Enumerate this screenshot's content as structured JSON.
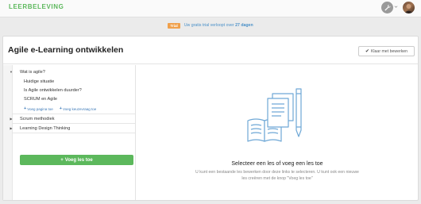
{
  "app": {
    "logo": "LEERBELEVING"
  },
  "trial": {
    "badge": "Trial",
    "text": "Uw gratis trial verloopt over",
    "days": "27 dagen"
  },
  "header": {
    "title": "Agile e-Learning ontwikkelen",
    "done_button": "Klaar met bewerken"
  },
  "sidebar": {
    "sections": [
      {
        "label": "Wat is agile?",
        "expanded": true,
        "lessons": [
          "Huidige situatie",
          "Is Agile ontwikkelen duurder?",
          "SCRUM en Agile"
        ],
        "add_page": "Voeg pagina toe",
        "add_choice": "Voeg keuzevraag toe"
      },
      {
        "label": "Scrum methodiek",
        "expanded": false
      },
      {
        "label": "Learning Design Thinking",
        "expanded": false
      }
    ],
    "add_lesson_button": "Voeg les toe"
  },
  "empty_state": {
    "title": "Selecteer een les of voeg een les toe",
    "description": "U kunt een bestaande les bewerken door deze links te selecteren. U kunt ook een nieuwe les creëren met de knop \"Voeg les toe\""
  },
  "colors": {
    "accent": "#5cb85c",
    "link": "#3d7ab8",
    "trial_badge": "#f0a04b",
    "illustration": "#6fa8d6"
  }
}
